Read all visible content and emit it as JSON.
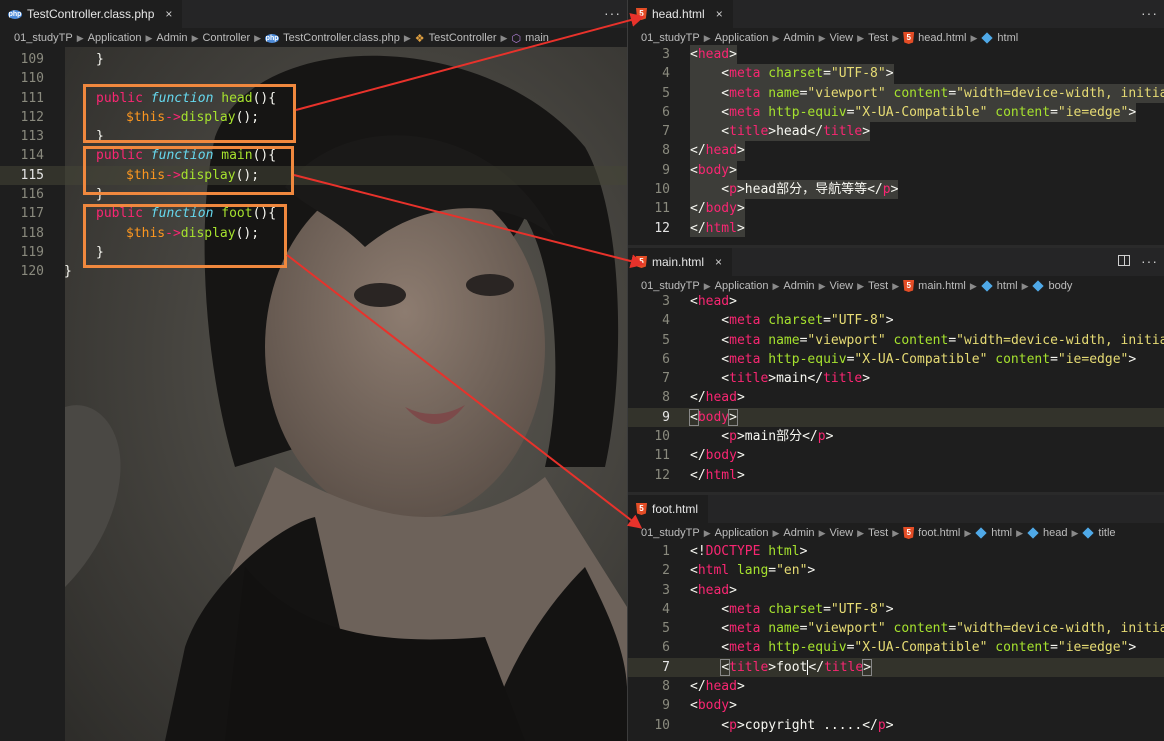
{
  "left_editor": {
    "tab_label": "TestController.class.php",
    "tab_close": "×",
    "more": "···",
    "breadcrumb": [
      "01_studyTP",
      "Application",
      "Admin",
      "Controller",
      "TestController.class.php",
      "TestController",
      "main"
    ],
    "line_numbers": [
      "109",
      "110",
      "111",
      "112",
      "113",
      "114",
      "115",
      "116",
      "117",
      "118",
      "119",
      "120"
    ],
    "current_line": "115",
    "code": {
      "close1": "}",
      "public": "public",
      "function": "function",
      "head_name": "head",
      "main_name": "main",
      "foot_name": "foot",
      "parens_open": "(){",
      "this": "$this",
      "arrow": "->",
      "display": "display",
      "call": "();",
      "close": "}",
      "final_close": "}"
    }
  },
  "head_panel": {
    "tab_label": "head.html",
    "tab_close": "×",
    "more": "···",
    "breadcrumb": [
      "01_studyTP",
      "Application",
      "Admin",
      "View",
      "Test",
      "head.html",
      "html"
    ],
    "line_numbers": [
      "3",
      "4",
      "5",
      "6",
      "7",
      "8",
      "9",
      "10",
      "11",
      "12"
    ],
    "current_line": "12",
    "p_text": "head部分，导航等等",
    "title_text": "head"
  },
  "main_panel": {
    "tab_label": "main.html",
    "tab_close": "×",
    "more": "···",
    "breadcrumb": [
      "01_studyTP",
      "Application",
      "Admin",
      "View",
      "Test",
      "main.html",
      "html",
      "body"
    ],
    "line_numbers": [
      "3",
      "4",
      "5",
      "6",
      "7",
      "8",
      "9",
      "10",
      "11",
      "12"
    ],
    "current_line": "9",
    "p_text": "main部分",
    "title_text": "main"
  },
  "foot_panel": {
    "tab_label": "foot.html",
    "breadcrumb": [
      "01_studyTP",
      "Application",
      "Admin",
      "View",
      "Test",
      "foot.html",
      "html",
      "head",
      "title"
    ],
    "line_numbers": [
      "1",
      "2",
      "3",
      "4",
      "5",
      "6",
      "7",
      "8",
      "9",
      "10"
    ],
    "current_line": "7",
    "p_text": "copyright .....",
    "title_text": "foot",
    "doctype_kw": "DOCTYPE",
    "doctype_val": "html",
    "lang_attr": "lang",
    "lang_val": "\"en\""
  },
  "html_tokens": {
    "head": "head",
    "body": "body",
    "html": "html",
    "meta": "meta",
    "title": "title",
    "p": "p",
    "charset": "charset",
    "charset_val": "\"UTF-8\"",
    "name": "name",
    "name_val": "\"viewport\"",
    "content": "content",
    "content_val": "\"width=device-width, initia",
    "http_equiv": "http-equiv",
    "http_equiv_val": "\"X-UA-Compatible\"",
    "content2_val": "\"ie=edge\""
  },
  "colors": {
    "annotation_box": "#f0883e",
    "arrow": "#e8322b",
    "keyword": "#f92672",
    "function": "#a6e22e",
    "string": "#e6db74"
  }
}
